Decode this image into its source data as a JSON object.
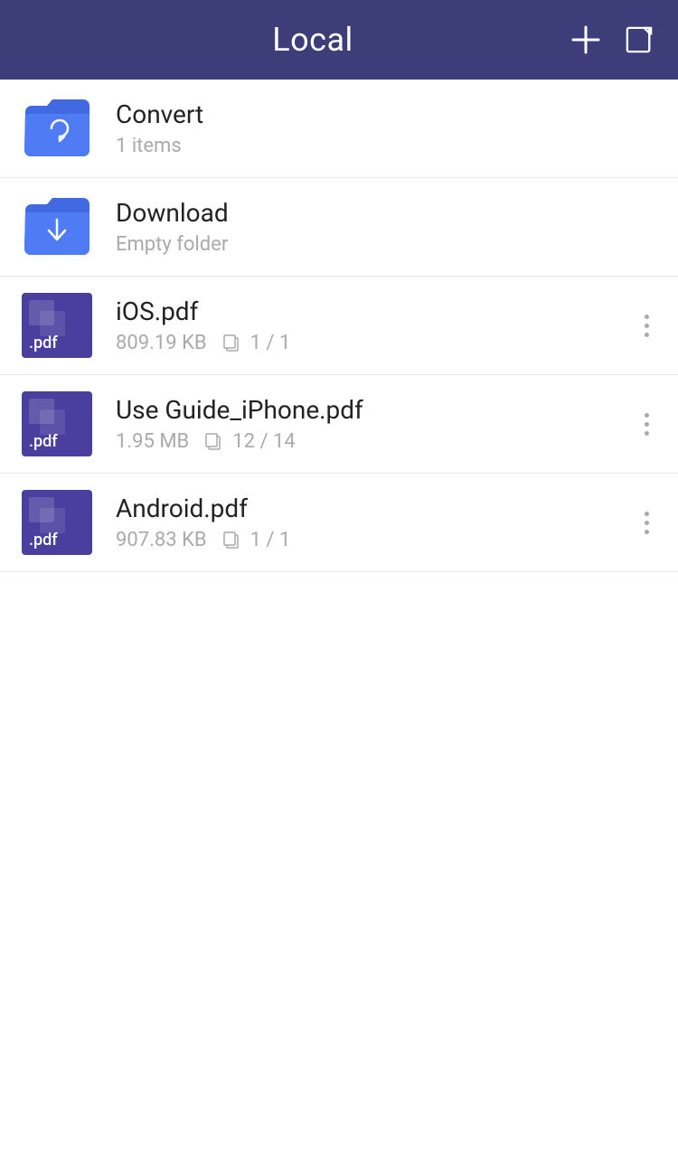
{
  "header": {
    "title": "Local",
    "menu_label": "menu",
    "add_label": "add",
    "edit_label": "edit"
  },
  "colors": {
    "header_bg": "#3d3d7a",
    "folder_blue": "#4169e1",
    "pdf_purple": "#4a3f9f",
    "text_dark": "#222222",
    "text_meta": "#aaaaaa",
    "divider": "#e8e8e8"
  },
  "items": [
    {
      "id": "convert",
      "type": "folder",
      "variant": "convert",
      "name": "Convert",
      "meta": "1 items",
      "has_more": false
    },
    {
      "id": "download",
      "type": "folder",
      "variant": "download",
      "name": "Download",
      "meta": "Empty folder",
      "has_more": false
    },
    {
      "id": "ios-pdf",
      "type": "pdf",
      "name": "iOS.pdf",
      "size": "809.19 KB",
      "pages": "1 / 1",
      "has_more": true
    },
    {
      "id": "use-guide-iphone-pdf",
      "type": "pdf",
      "name": "Use Guide_iPhone.pdf",
      "size": "1.95 MB",
      "pages": "12 / 14",
      "has_more": true
    },
    {
      "id": "android-pdf",
      "type": "pdf",
      "name": "Android.pdf",
      "size": "907.83 KB",
      "pages": "1 / 1",
      "has_more": true
    }
  ],
  "pdf_label": ".pdf"
}
